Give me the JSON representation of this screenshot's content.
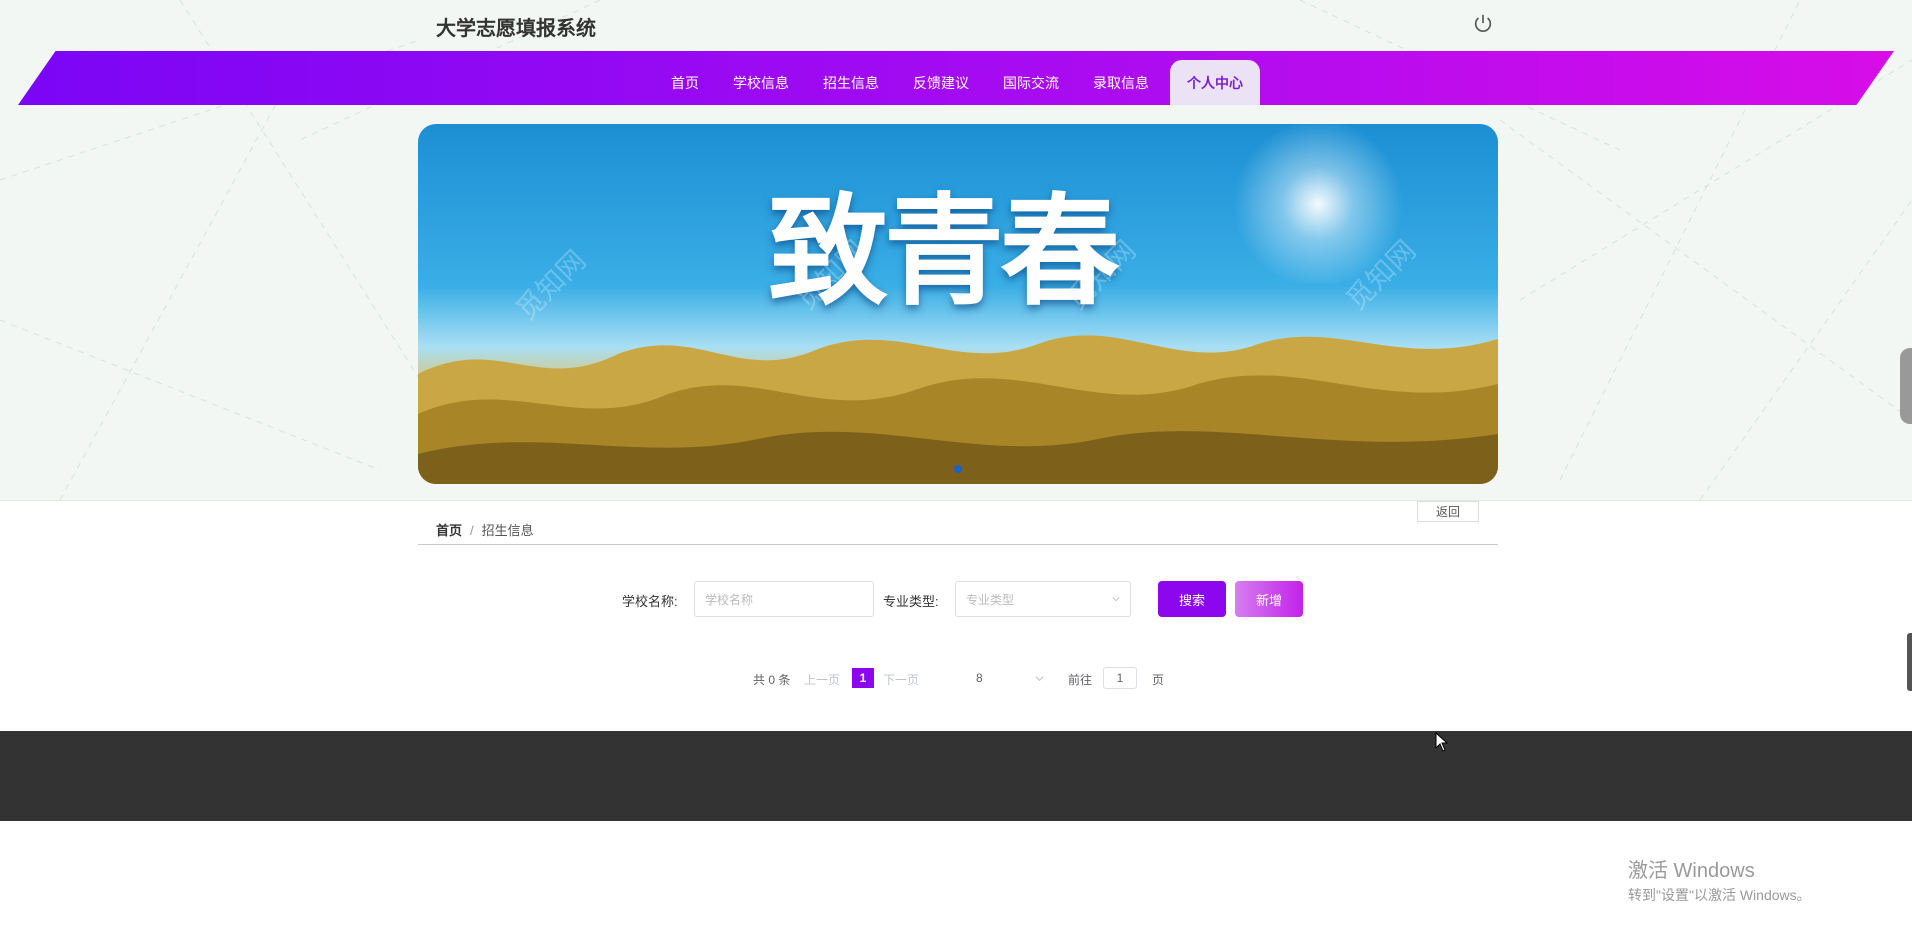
{
  "app": {
    "title": "大学志愿填报系统"
  },
  "nav": {
    "items": [
      {
        "label": "首页"
      },
      {
        "label": "学校信息"
      },
      {
        "label": "招生信息"
      },
      {
        "label": "反馈建议"
      },
      {
        "label": "国际交流"
      },
      {
        "label": "录取信息"
      },
      {
        "label": "个人中心"
      }
    ],
    "active": "个人中心"
  },
  "banner": {
    "title": "致青春",
    "watermark": "觅知网"
  },
  "breadcrumb": {
    "home": "首页",
    "separator": "/",
    "current": "招生信息"
  },
  "back_label": "返回",
  "search_form": {
    "school_label": "学校名称:",
    "school_placeholder": "学校名称",
    "major_label": "专业类型:",
    "major_placeholder": "专业类型",
    "search_label": "搜索",
    "add_label": "新增"
  },
  "pagination": {
    "total_text": "共 0 条",
    "prev_label": "上一页",
    "current_page": "1",
    "next_label": "下一页",
    "page_size": "8",
    "goto_label": "前往",
    "goto_value": "1",
    "page_unit": "页"
  },
  "os_overlay": {
    "line1": "激活 Windows",
    "line2": "转到\"设置\"以激活 Windows。"
  },
  "colors": {
    "accent": "#8c07ee",
    "nav_gradient_start": "#7b05f5",
    "nav_gradient_end": "#d70de8",
    "footer": "#333333"
  }
}
